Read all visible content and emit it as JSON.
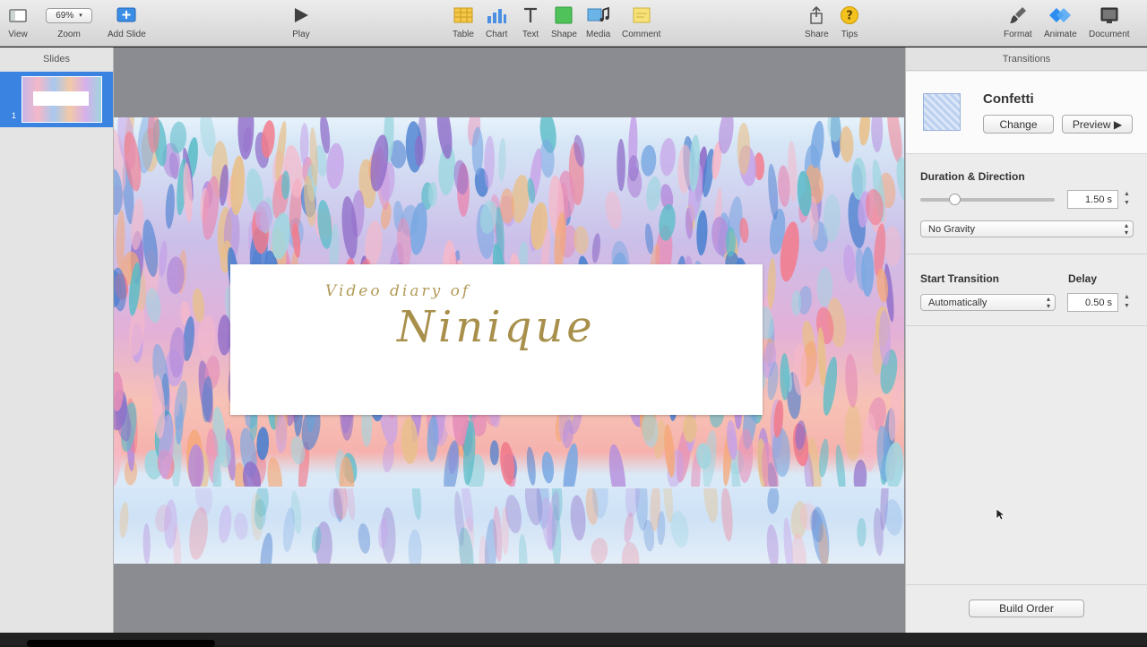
{
  "toolbar": {
    "view_label": "View",
    "zoom_value": "69%",
    "zoom_label": "Zoom",
    "add_slide_label": "Add Slide",
    "play_label": "Play",
    "table_label": "Table",
    "chart_label": "Chart",
    "text_label": "Text",
    "shape_label": "Shape",
    "media_label": "Media",
    "comment_label": "Comment",
    "share_label": "Share",
    "tips_label": "Tips",
    "format_label": "Format",
    "animate_label": "Animate",
    "document_label": "Document"
  },
  "slides_panel": {
    "header": "Slides",
    "slides": [
      {
        "number": "1"
      }
    ]
  },
  "slide": {
    "subtitle": "Video diary of",
    "title": "Ninique"
  },
  "inspector": {
    "header": "Transitions",
    "transition_name": "Confetti",
    "change_label": "Change",
    "preview_label": "Preview ▶",
    "duration_direction_label": "Duration & Direction",
    "duration_value": "1.50 s",
    "duration_slider_fraction": 0.25,
    "gravity_option": "No Gravity",
    "start_transition_label": "Start Transition",
    "start_option": "Automatically",
    "delay_label": "Delay",
    "delay_value": "0.50 s",
    "build_order_label": "Build Order"
  },
  "colors": {
    "selection_blue": "#3b83e0",
    "title_gold": "#a8904c",
    "canvas_gray": "#8a8c91"
  }
}
